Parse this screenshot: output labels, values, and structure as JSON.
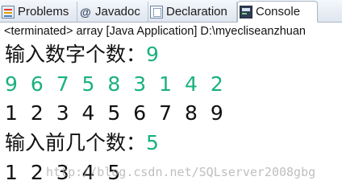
{
  "tabs": [
    {
      "label": "Problems",
      "icon": "problems-icon"
    },
    {
      "label": "Javadoc",
      "icon": "at-icon"
    },
    {
      "label": "Declaration",
      "icon": "declaration-icon"
    },
    {
      "label": "Console",
      "icon": "console-icon"
    }
  ],
  "console": {
    "status": "<terminated> array [Java Application] D:\\myecliseanzhuan",
    "prompt1": "输入数字个数：",
    "answer1": "9",
    "input_digits": "9 6 7 5 8 3 1 4 2",
    "sorted_digits": "1 2 3 4 5 6 7 8 9",
    "prompt2": "输入前几个数：",
    "answer2": "5",
    "first_digits": "1 2 3 4 5"
  },
  "watermark": "http://blog.csdn.net/SQLserver2008gbg",
  "colors": {
    "input_green": "#19b27c",
    "text": "#111111"
  }
}
